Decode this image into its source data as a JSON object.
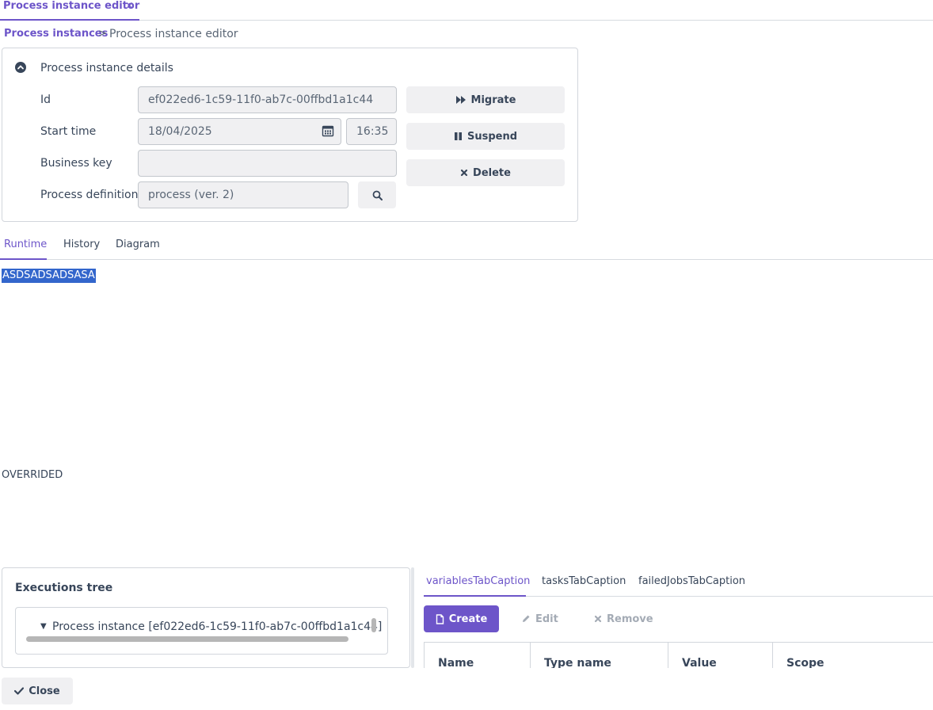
{
  "top_tab": {
    "label": "Process instance editor",
    "close": "×"
  },
  "breadcrumb": {
    "link": "Process instances",
    "separator": ">",
    "current": "Process instance editor"
  },
  "details": {
    "title": "Process instance details",
    "id_label": "Id",
    "id_value": "ef022ed6-1c59-11f0-ab7c-00ffbd1a1c44",
    "start_label": "Start time",
    "start_date": "18/04/2025",
    "start_time": "16:35",
    "business_key_label": "Business key",
    "business_key_value": "",
    "process_def_label": "Process definition",
    "process_def_value": "process (ver. 2)"
  },
  "actions": {
    "migrate": "Migrate",
    "suspend": "Suspend",
    "delete": "Delete"
  },
  "tabs": {
    "runtime": "Runtime",
    "history": "History",
    "diagram": "Diagram"
  },
  "runtime": {
    "selected_text": "ASDSADSADSASA",
    "overrided": "OVERRIDED"
  },
  "executions": {
    "title": "Executions tree",
    "item": "Process instance [ef022ed6-1c59-11f0-ab7c-00ffbd1a1c44]"
  },
  "lower_tabs": {
    "variables": "variablesTabCaption",
    "tasks": "tasksTabCaption",
    "failed_jobs": "failedJobsTabCaption"
  },
  "variables_toolbar": {
    "create": "Create",
    "edit": "Edit",
    "remove": "Remove"
  },
  "variables_grid": {
    "columns": [
      "Name",
      "Type name",
      "Value",
      "Scope"
    ]
  },
  "footer": {
    "close": "Close"
  },
  "colors": {
    "accent": "#6d55c9",
    "text": "#38465a",
    "selection": "#3366cc"
  }
}
